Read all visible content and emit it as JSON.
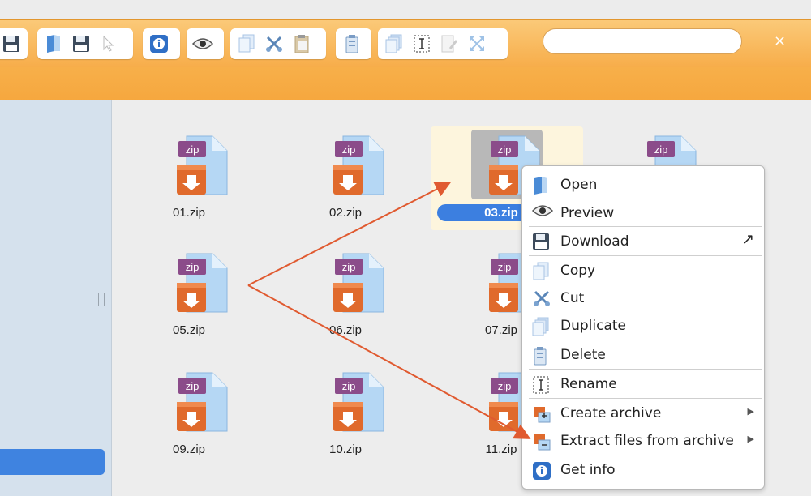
{
  "search": {
    "placeholder": ""
  },
  "toolbar": {
    "close_glyph": "×",
    "groups": [
      [
        "save-icon"
      ],
      [
        "open-icon",
        "download-icon",
        "select-icon"
      ],
      [
        "info-icon"
      ],
      [
        "preview-icon"
      ],
      [
        "copy-icon",
        "cut-icon",
        "paste-icon"
      ],
      [
        "delete-icon"
      ],
      [
        "duplicate-icon",
        "rename-icon",
        "edit-icon",
        "resize-icon"
      ]
    ]
  },
  "files": [
    {
      "name": "01.zip",
      "label": "zip"
    },
    {
      "name": "02.zip",
      "label": "zip"
    },
    {
      "name": "03.zip",
      "label": "zip",
      "selected": true
    },
    {
      "name": "",
      "label": "zip"
    },
    {
      "name": "05.zip",
      "label": "zip"
    },
    {
      "name": "06.zip",
      "label": "zip"
    },
    {
      "name": "07.zip",
      "label": "zip"
    },
    {
      "name": "09.zip",
      "label": "zip"
    },
    {
      "name": "10.zip",
      "label": "zip"
    },
    {
      "name": "11.zip",
      "label": "zip"
    }
  ],
  "context_menu": {
    "items": [
      {
        "label": "Open",
        "icon": "open-icon"
      },
      {
        "label": "Preview",
        "icon": "preview-icon"
      },
      {
        "label": "Download",
        "icon": "download-icon",
        "trailing": "↗"
      },
      {
        "label": "Copy",
        "icon": "copy-icon"
      },
      {
        "label": "Cut",
        "icon": "cut-icon"
      },
      {
        "label": "Duplicate",
        "icon": "duplicate-icon"
      },
      {
        "label": "Delete",
        "icon": "delete-icon"
      },
      {
        "label": "Rename",
        "icon": "rename-icon"
      },
      {
        "label": "Create archive",
        "icon": "archive-icon",
        "submenu": "▶"
      },
      {
        "label": "Extract files from archive",
        "icon": "extract-icon",
        "submenu": "▶"
      },
      {
        "label": "Get info",
        "icon": "info-icon"
      }
    ]
  },
  "colors": {
    "toolbar": "#f7ad4a",
    "selection": "#3c7fe0",
    "arrow": "#e05a30",
    "sidebar": "#d5e1ed",
    "zip_orange": "#e06a2c",
    "zip_purple": "#8b4c8a",
    "doc_blue": "#a9cdef"
  }
}
